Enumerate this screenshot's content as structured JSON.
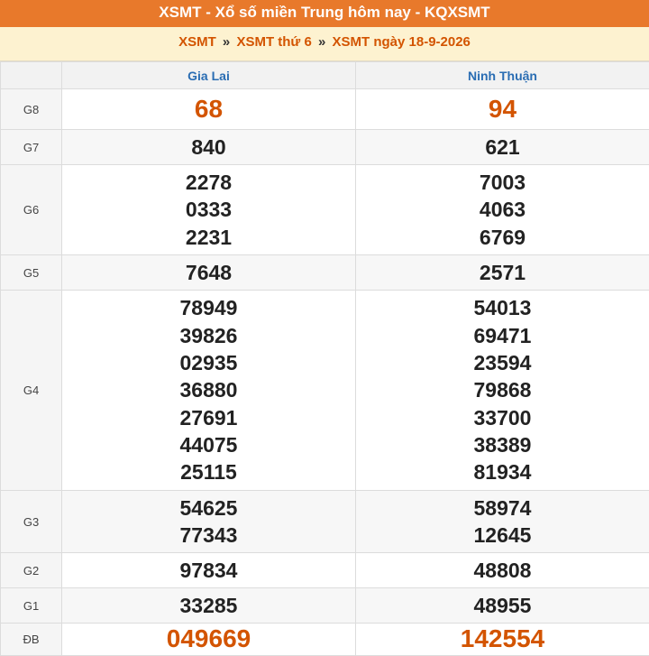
{
  "header": {
    "title": "XSMT - Xổ số miền Trung hôm nay - KQXSMT"
  },
  "breadcrumb": {
    "items": [
      "XSMT",
      "XSMT thứ 6",
      "XSMT ngày 18-9-2026"
    ],
    "separator": "»"
  },
  "table": {
    "provinces": [
      "Gia Lai",
      "Ninh Thuận"
    ],
    "rows": [
      {
        "label": "G8",
        "values": [
          [
            "68"
          ],
          [
            "94"
          ]
        ]
      },
      {
        "label": "G7",
        "values": [
          [
            "840"
          ],
          [
            "621"
          ]
        ]
      },
      {
        "label": "G6",
        "values": [
          [
            "2278",
            "0333",
            "2231"
          ],
          [
            "7003",
            "4063",
            "6769"
          ]
        ]
      },
      {
        "label": "G5",
        "values": [
          [
            "7648"
          ],
          [
            "2571"
          ]
        ]
      },
      {
        "label": "G4",
        "values": [
          [
            "78949",
            "39826",
            "02935",
            "36880",
            "27691",
            "44075",
            "25115"
          ],
          [
            "54013",
            "69471",
            "23594",
            "79868",
            "33700",
            "38389",
            "81934"
          ]
        ]
      },
      {
        "label": "G3",
        "values": [
          [
            "54625",
            "77343"
          ],
          [
            "58974",
            "12645"
          ]
        ]
      },
      {
        "label": "G2",
        "values": [
          [
            "97834"
          ],
          [
            "48808"
          ]
        ]
      },
      {
        "label": "G1",
        "values": [
          [
            "33285"
          ],
          [
            "48955"
          ]
        ]
      },
      {
        "label": "ĐB",
        "values": [
          [
            "049669"
          ],
          [
            "142554"
          ]
        ]
      }
    ]
  },
  "colors": {
    "title_bar": "#e8792b",
    "breadcrumb_bg": "#fdf2d0",
    "accent_orange": "#d35400",
    "province_blue": "#2a6db3"
  }
}
